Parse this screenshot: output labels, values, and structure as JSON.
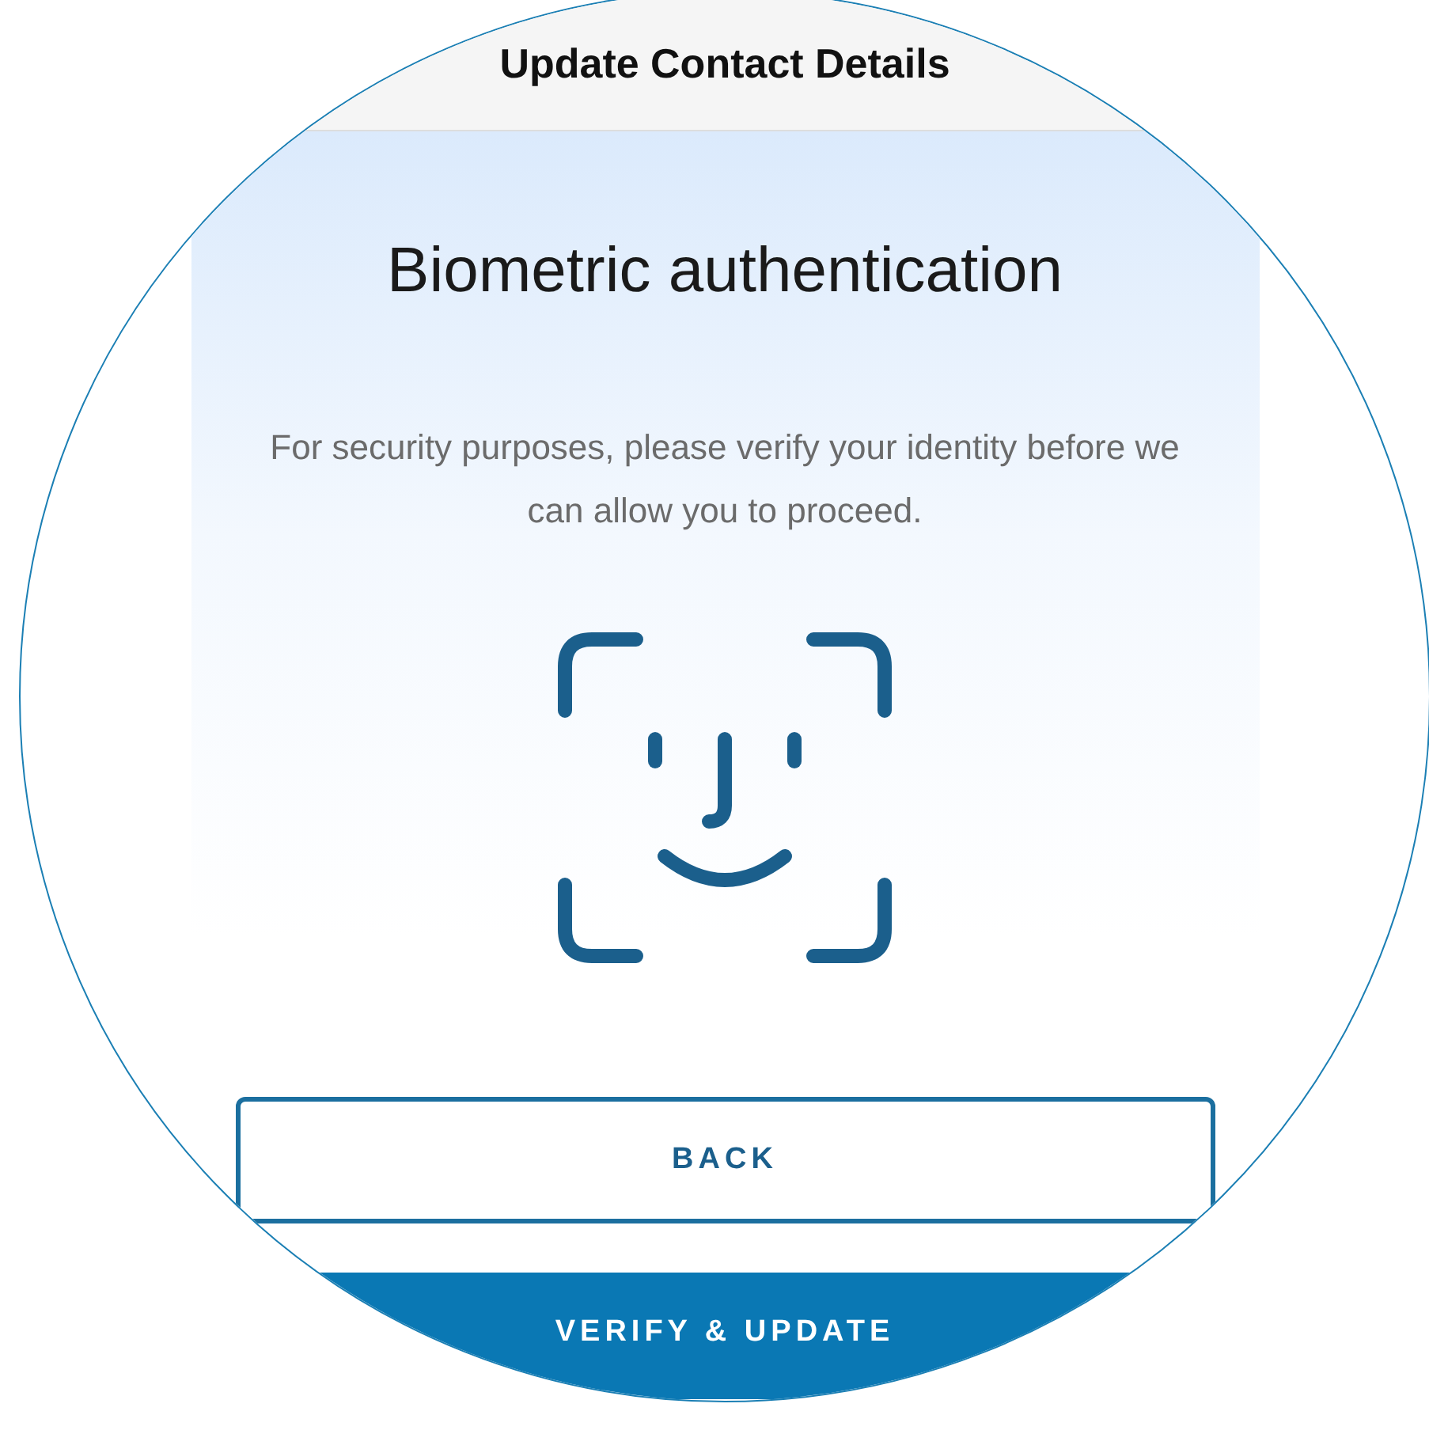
{
  "header": {
    "title": "Update Contact Details"
  },
  "heading": "Biometric authentication",
  "message": "For security purposes, please verify your identity before we can allow you to proceed.",
  "buttons": [
    {
      "label": "BACK",
      "kind": "outline"
    },
    {
      "label": "VERIFY & UPDATE",
      "kind": "filled"
    }
  ]
}
